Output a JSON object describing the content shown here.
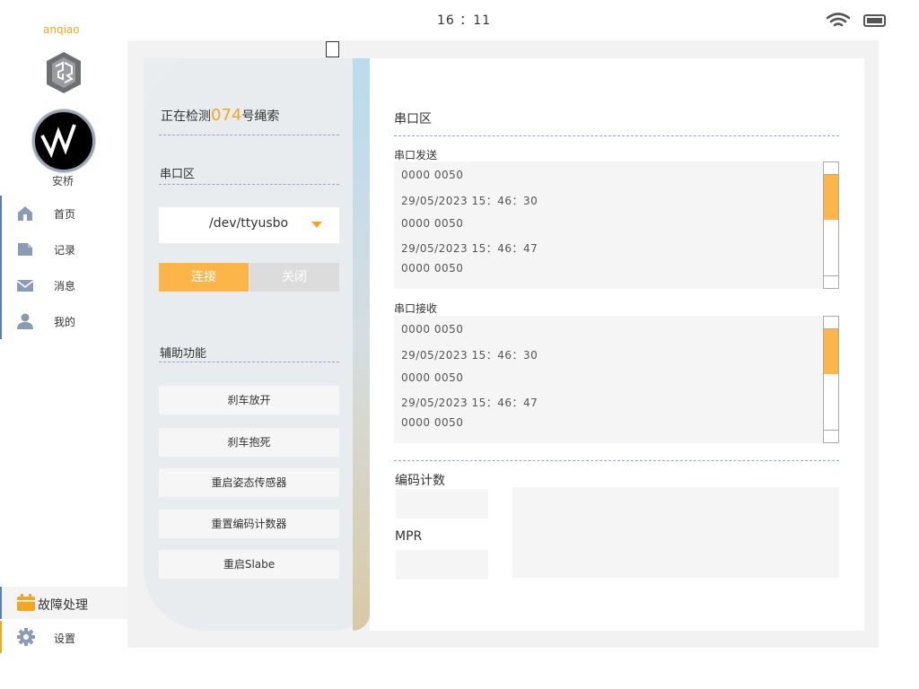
{
  "status_bar": {
    "time": "16 ：11"
  },
  "sidebar": {
    "brand": "anqiao",
    "user_name": "安桥",
    "items": [
      {
        "label": "首页",
        "icon": "home-icon"
      },
      {
        "label": "记录",
        "icon": "document-icon"
      },
      {
        "label": "消息",
        "icon": "mail-icon"
      },
      {
        "label": "我的",
        "icon": "user-icon"
      }
    ],
    "fault": {
      "label": "故障处理",
      "icon": "calendar-icon"
    },
    "settings": {
      "label": "设置",
      "icon": "gear-icon"
    }
  },
  "left_panel": {
    "title_prefix": "正在检测",
    "rope_number": "074",
    "title_suffix": "号绳索",
    "serial_label": "串口区",
    "port_value": "/dev/ttyusbo",
    "connect_label": "连接",
    "close_label": "关闭",
    "aux_label": "辅助功能",
    "aux_buttons": [
      "刹车放开",
      "刹车抱死",
      "重启姿态传感器",
      "重置编码计数器",
      "重启Slabe"
    ]
  },
  "right_panel": {
    "title": "串口区",
    "send_label": "串口发送",
    "send_lines": [
      "0000 0050",
      "29/05/2023 15：46：30",
      "0000 0050",
      "29/05/2023 15：46：47",
      "0000 0050"
    ],
    "recv_label": "串口接收",
    "recv_lines": [
      "0000 0050",
      "29/05/2023 15：46：30",
      "0000 0050",
      "29/05/2023 15：46：47",
      "0000 0050"
    ],
    "encoder_label": "编码计数",
    "mpr_label": "MPR"
  },
  "colors": {
    "accent": "#f2a623",
    "button_orange": "#fbb549",
    "nav_border": "#5b7fb8"
  }
}
